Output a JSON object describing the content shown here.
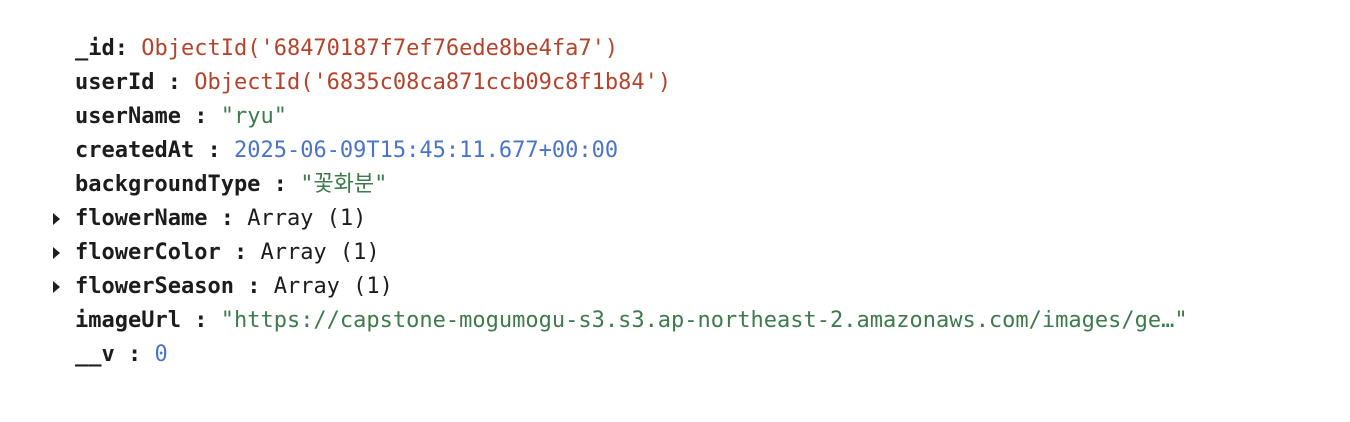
{
  "document": {
    "fields": [
      {
        "key": "_id",
        "sep": ": ",
        "value": "ObjectId('68470187f7ef76ede8be4fa7')",
        "type": "oid",
        "expandable": false
      },
      {
        "key": "userId",
        "sep": " : ",
        "value": "ObjectId('6835c08ca871ccb09c8f1b84')",
        "type": "oid",
        "expandable": false
      },
      {
        "key": "userName",
        "sep": " : ",
        "value": "\"ryu\"",
        "type": "str",
        "expandable": false
      },
      {
        "key": "createdAt",
        "sep": " : ",
        "value": "2025-06-09T15:45:11.677+00:00",
        "type": "date",
        "expandable": false
      },
      {
        "key": "backgroundType",
        "sep": " : ",
        "value": "\"꽃화분\"",
        "type": "str",
        "expandable": false
      },
      {
        "key": "flowerName",
        "sep": " : ",
        "value": "Array (1)",
        "type": "arr",
        "expandable": true
      },
      {
        "key": "flowerColor",
        "sep": " : ",
        "value": "Array (1)",
        "type": "arr",
        "expandable": true
      },
      {
        "key": "flowerSeason",
        "sep": " : ",
        "value": "Array (1)",
        "type": "arr",
        "expandable": true
      },
      {
        "key": "imageUrl",
        "sep": " : ",
        "value": "\"https://capstone-mogumogu-s3.s3.ap-northeast-2.amazonaws.com/images/ge…\"",
        "type": "str",
        "expandable": false
      },
      {
        "key": "__v",
        "sep": " : ",
        "value": "0",
        "type": "num",
        "expandable": false
      }
    ]
  },
  "colors": {
    "objectid": "#b5432b",
    "string": "#3d7a4c",
    "date": "#4a74c9",
    "number": "#4a74c9",
    "key": "#1c1c1c"
  },
  "icons": {
    "expand": "caret-right-icon"
  }
}
